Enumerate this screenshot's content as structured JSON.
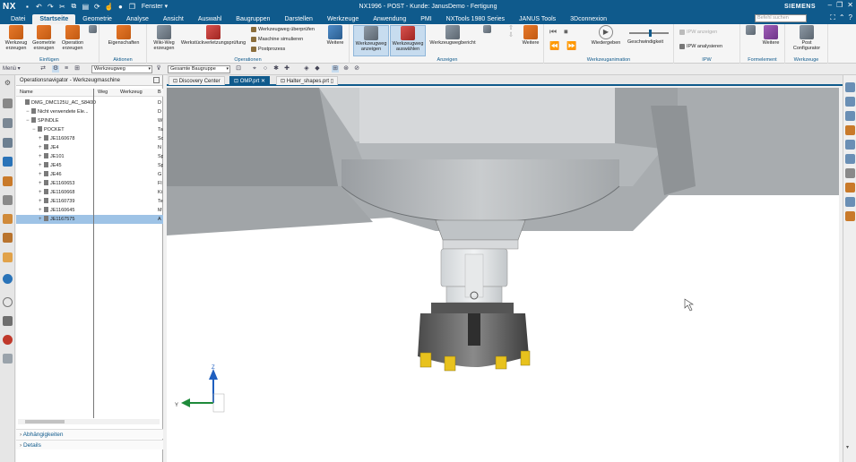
{
  "titlebar": {
    "logo": "NX",
    "fenster": "Fenster ▾",
    "title": "NX1996 - POST - Kunde: JanusDemo - Fertigung",
    "brand": "SIEMENS"
  },
  "menutabs": [
    "Datei",
    "Startseite",
    "Geometrie",
    "Analyse",
    "Ansicht",
    "Auswahl",
    "Baugruppen",
    "Darstellen",
    "Werkzeuge",
    "Anwendung",
    "PMI",
    "NXTools 1980 Series",
    "JANUS Tools",
    "3Dconnexion"
  ],
  "search_placeholder": "Befehl suchen",
  "ribbon": {
    "groups": {
      "einfuegen": "Einfügen",
      "aktionen": "Aktionen",
      "operationen": "Operationen",
      "anzeigen": "Anzeigen",
      "animation": "Werkzeuganimation",
      "ipw": "IPW",
      "formelement": "Formelement",
      "werkzeuge": "Werkzeuge"
    },
    "buttons": {
      "werkzeug": "Werkzeug\nerzeugen",
      "geometrie": "Geometrie\nerzeugen",
      "operation": "Operation\nerzeugen",
      "eigenschaften": "Eigenschaften",
      "wiki": "Wiki-Weg\nerzeugen",
      "verletzung": "Werkstückverletzungsprüfung",
      "ueberpruefen": "Werkzeugweg überprüfen",
      "simulieren": "Maschine simulieren",
      "postprozess": "Postprozess",
      "weitere1": "Weitere",
      "wz_anzeigen": "Werkzeugweg\nanzeigen",
      "wz_auswaehlen": "Werkzeugweg\nauswählen",
      "wz_bericht": "Werkzeugwegbericht",
      "weitere2": "Weitere",
      "wiedergeben": "Wiedergeben",
      "geschwindigkeit": "Geschwindigkeit",
      "ipw_anzeigen": "IPW anzeigen",
      "ipw_analysieren": "IPW analysieren",
      "weitere3": "Weitere",
      "post_config": "Post\nConfigurator"
    }
  },
  "toolbar2": {
    "menu": "Menü ▾",
    "filter": "Werkzeugweg",
    "scope": "Gesamte Baugruppe"
  },
  "navigator": {
    "title": "Operationsnavigator - Werkzeugmaschine",
    "columns": {
      "name": "Name",
      "weg": "Weg",
      "werkzeug": "Werkzeug",
      "b": "B"
    },
    "rows": [
      {
        "name": "DMG_DMC125U_AC_S840D",
        "b": "D",
        "indent": 0
      },
      {
        "name": "Nicht verwendete Ele...",
        "b": "D",
        "indent": 1
      },
      {
        "name": "SPINDLE",
        "b": "W",
        "indent": 1
      },
      {
        "name": "POCKET",
        "b": "Ta",
        "indent": 2
      },
      {
        "name": "JE1160678",
        "b": "Sc",
        "indent": 3
      },
      {
        "name": "JE4",
        "b": "N",
        "indent": 3
      },
      {
        "name": "JE101",
        "b": "Sp",
        "indent": 3
      },
      {
        "name": "JE45",
        "b": "Sp",
        "indent": 3
      },
      {
        "name": "JE46",
        "b": "G",
        "indent": 3
      },
      {
        "name": "JE1160653",
        "b": "Fl",
        "indent": 3
      },
      {
        "name": "JE1160668",
        "b": "Ki",
        "indent": 3
      },
      {
        "name": "JE1160739",
        "b": "Te",
        "indent": 3
      },
      {
        "name": "JE1160645",
        "b": "M",
        "indent": 3
      },
      {
        "name": "JE1167575",
        "b": "A",
        "indent": 3,
        "selected": true
      }
    ],
    "sections": {
      "abhaengigkeiten": "Abhängigkeiten",
      "details": "Details"
    }
  },
  "doctabs": {
    "discovery": "Discovery Center",
    "omp": "OMP.prt",
    "halter": "Halter_shapes.prt"
  },
  "axes": {
    "z": "Z",
    "y": "Y"
  },
  "colors": {
    "titlebar": "#0f5a8c",
    "selection": "#9ec3e6",
    "machine_gray": "#b8bcbf",
    "insert_yellow": "#e8c21d"
  }
}
